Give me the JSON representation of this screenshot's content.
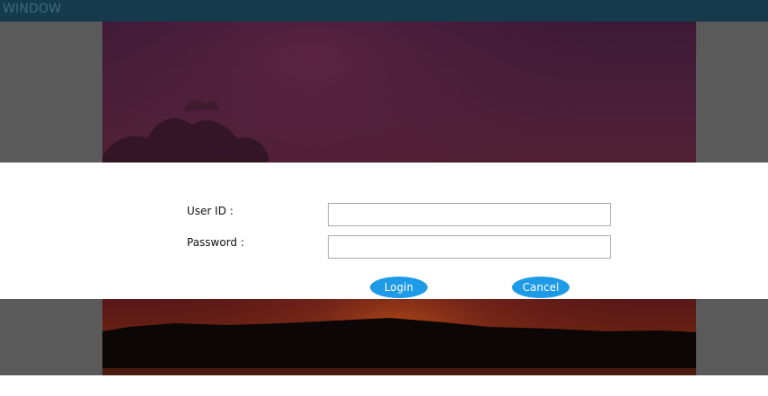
{
  "window": {
    "title": "WINDOW"
  },
  "login_form": {
    "user_id_label": "User ID :",
    "user_id_value": "",
    "password_label": "Password :",
    "password_value": "",
    "login_label": "Login",
    "cancel_label": "Cancel"
  },
  "colors": {
    "titlebar": "#143a4c",
    "title_text": "#3e6a82",
    "button": "#1e9be6",
    "backdrop": "#5a5a5a"
  }
}
